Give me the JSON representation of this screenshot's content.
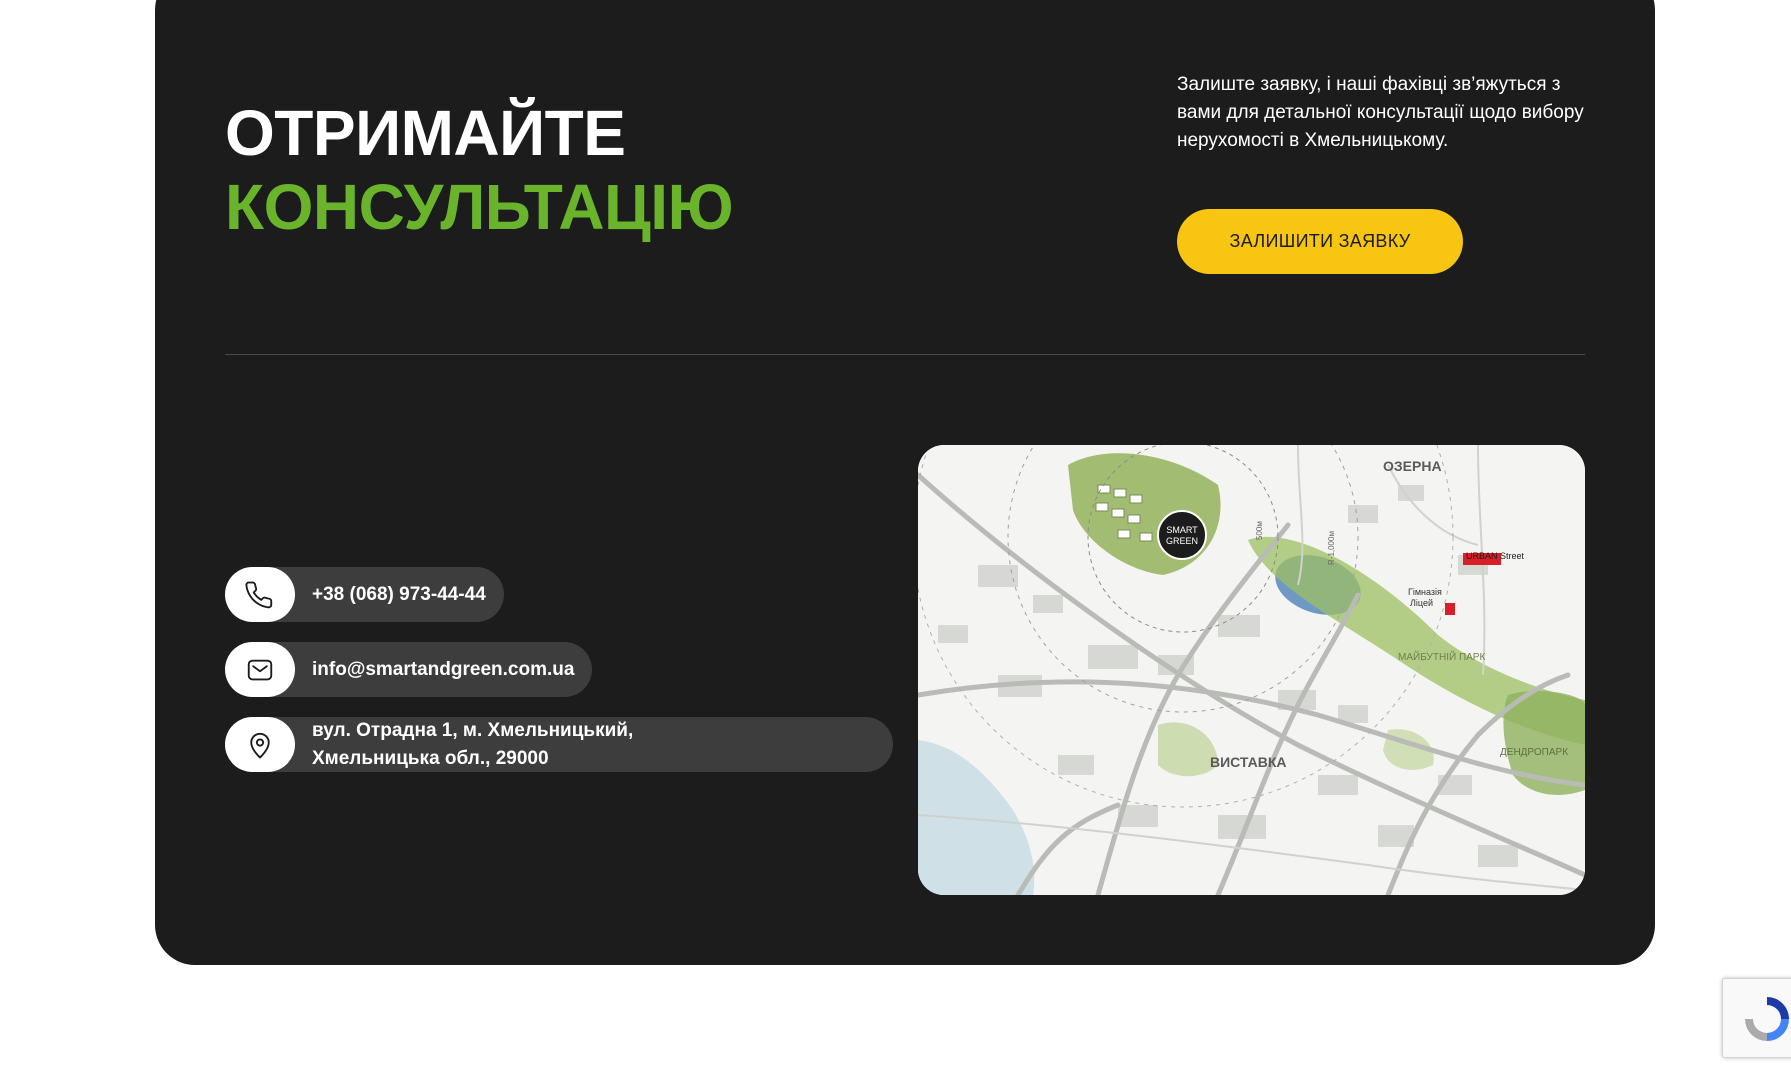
{
  "heading": {
    "line1": "ОТРИМАЙТЕ",
    "line2": "КОНСУЛЬТАЦІЮ"
  },
  "lead_text": "Залиште заявку, і наші фахівці зв’яжуться з вами для детальної консультації щодо вибору нерухомості в Хмельницькому.",
  "cta_label": "ЗАЛИШИТИ ЗАЯВКУ",
  "contacts": {
    "phone": "+38 (068) 973-44-44",
    "email": "info@smartandgreen.com.ua",
    "address_line1": "вул. Отрадна 1, м. Хмельницький,",
    "address_line2": "Хмельницька обл., 29000"
  },
  "map": {
    "logo_line1": "SMART",
    "logo_line2": "GREEN",
    "labels": {
      "ozerna": "ОЗЕРНА",
      "vystavka": "ВИСТАВКА",
      "park": "МАЙБУТНІЙ ПАРК",
      "dendropark": "ДЕНДРОПАРК",
      "gymnasium": "Гімназія",
      "lyceum": "Ліцей",
      "urban_street": "URBAN Street",
      "r1000": "R-1,000м",
      "r500": "500м"
    }
  },
  "colors": {
    "card_bg": "#1c1c1c",
    "accent_green": "#6ab42c",
    "cta_yellow": "#f8c512",
    "pill_bg": "#3d3d3d"
  },
  "icons": [
    "phone-icon",
    "mail-icon",
    "location-pin-icon",
    "recaptcha-icon"
  ]
}
